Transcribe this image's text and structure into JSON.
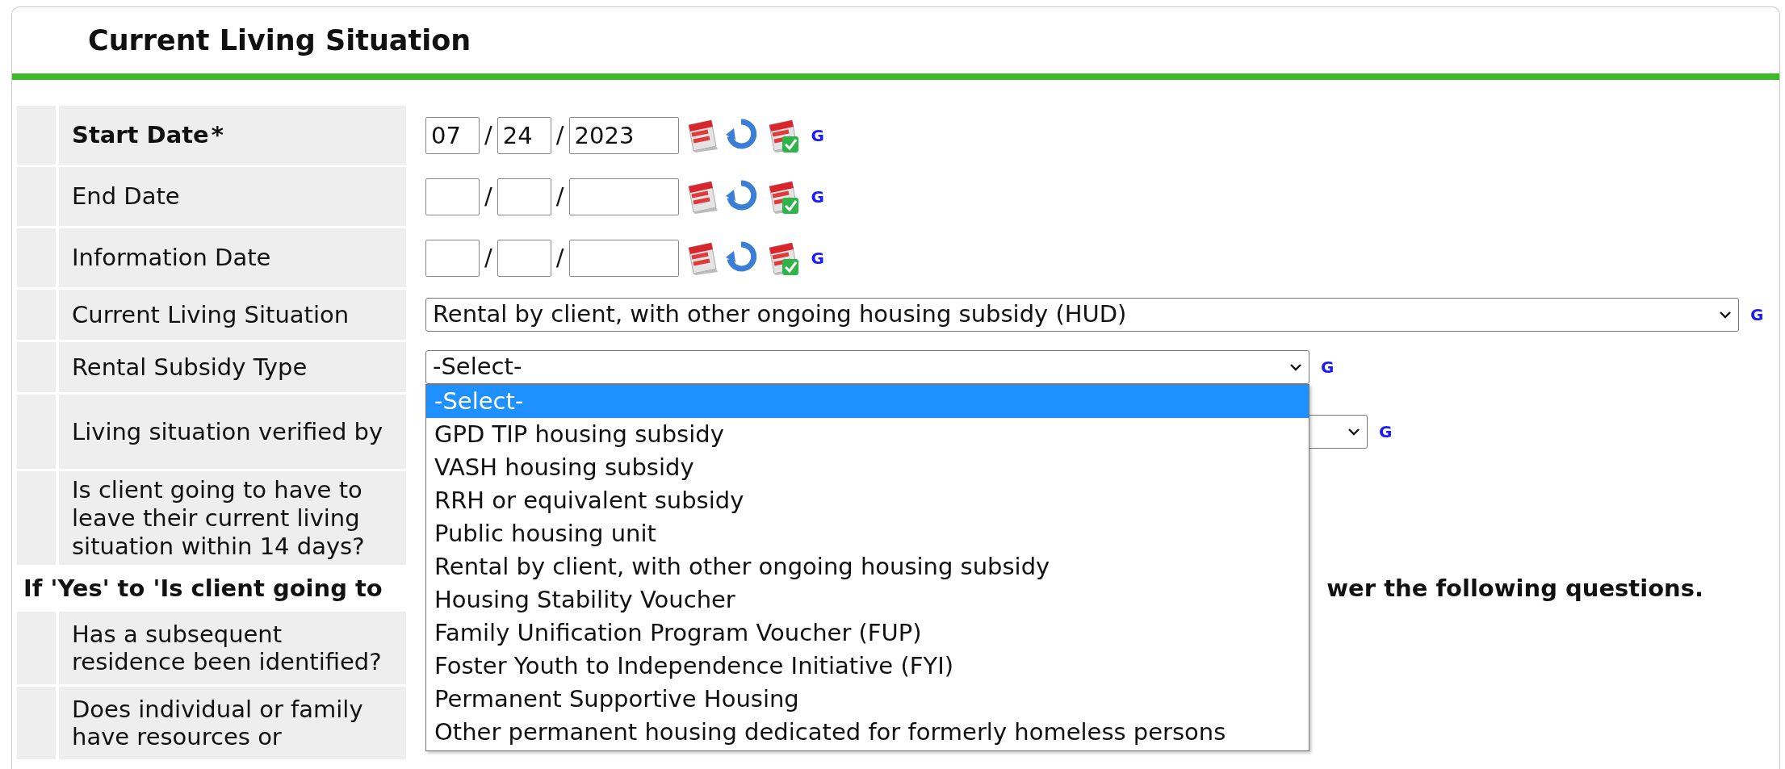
{
  "title": "Current Living Situation",
  "fields": [
    {
      "kind": "date",
      "label": "Start Date",
      "required_mark": "*",
      "month": "07",
      "day": "24",
      "year": "2023",
      "separators": [
        "/",
        "/"
      ],
      "link": "G"
    },
    {
      "kind": "date",
      "label": "End Date",
      "separators": [
        "/",
        "/"
      ],
      "link": "G"
    },
    {
      "kind": "date",
      "label": "Information Date",
      "separators": [
        "/",
        "/"
      ],
      "link": "G"
    },
    {
      "kind": "select",
      "label": "Current Living Situation",
      "value": "Rental by client, with other ongoing housing subsidy (HUD)",
      "link": "G"
    },
    {
      "kind": "select-open",
      "label": "Rental Subsidy Type",
      "value": "-Select-",
      "link": "G",
      "options": [
        {
          "label": "-Select-",
          "selected": true
        },
        {
          "label": "GPD TIP housing subsidy",
          "selected": false
        },
        {
          "label": "VASH housing subsidy",
          "selected": false
        },
        {
          "label": "RRH or equivalent subsidy",
          "selected": false
        },
        {
          "label": "Public housing unit",
          "selected": false
        },
        {
          "label": "Rental by client, with other ongoing housing subsidy",
          "selected": false
        },
        {
          "label": "Housing Stability Voucher",
          "selected": false
        },
        {
          "label": "Family Unification Program Voucher (FUP)",
          "selected": false
        },
        {
          "label": "Foster Youth to Independence Initiative (FYI)",
          "selected": false
        },
        {
          "label": "Permanent Supportive Housing",
          "selected": false
        },
        {
          "label": "Other permanent housing dedicated for formerly homeless persons",
          "selected": false
        }
      ]
    },
    {
      "kind": "select-covered",
      "label": "Living situation verified by",
      "link": "G"
    },
    {
      "kind": "question",
      "label": "Is client going to have to leave their current living situation within 14 days?"
    },
    {
      "kind": "note",
      "texts": [
        "If 'Yes' to 'Is client going to",
        "wer the following questions."
      ]
    },
    {
      "kind": "question",
      "label": "Has a subsequent residence been identified?"
    },
    {
      "kind": "question",
      "label": "Does individual or family have resources or"
    }
  ]
}
